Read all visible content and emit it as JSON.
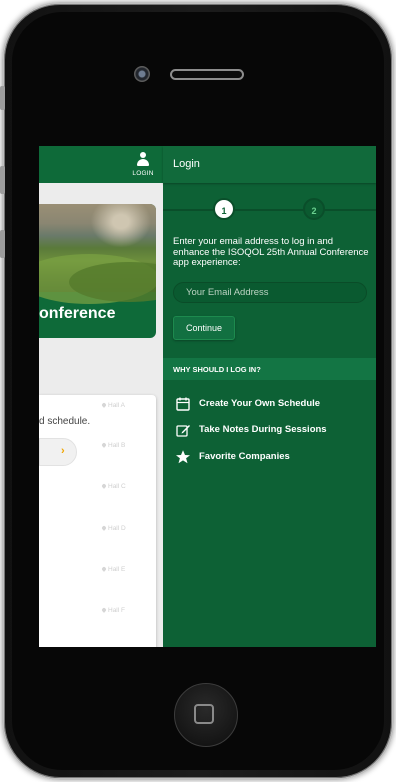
{
  "app": {
    "header": {
      "login_label": "LOGIN"
    },
    "hero": {
      "title": "onference"
    },
    "schedule_card": {
      "text": "d schedule.",
      "button_icon": "chevron-right-icon",
      "halls": [
        "Hall A",
        "Hall B",
        "Hall C",
        "Hall D",
        "Hall E",
        "Hall F"
      ]
    }
  },
  "login_panel": {
    "title": "Login",
    "steps": [
      "1",
      "2"
    ],
    "instructions": "Enter your email address to log in and enhance the ISOQOL 25th Annual Conference app experience:",
    "email_placeholder": "Your Email Address",
    "continue_label": "Continue",
    "why_heading": "WHY SHOULD I LOG IN?",
    "benefits": [
      {
        "icon": "calendar-icon",
        "label": "Create Your Own Schedule"
      },
      {
        "icon": "edit-note-icon",
        "label": "Take Notes During Sessions"
      },
      {
        "icon": "star-icon",
        "label": "Favorite Companies"
      }
    ]
  },
  "colors": {
    "panel_green": "#0d6135",
    "header_green": "#0e6a39",
    "accent_orange": "#f0a500"
  }
}
